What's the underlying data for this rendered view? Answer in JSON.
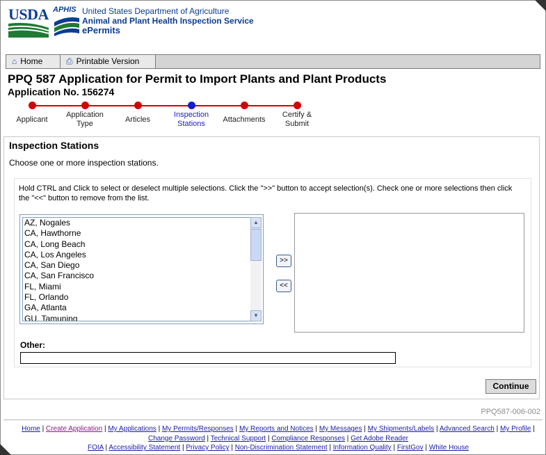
{
  "header": {
    "usda_logo_text": "USDA",
    "aphis_logo_text": "APHIS",
    "agency_line1": "United States Department of Agriculture",
    "agency_line2": "Animal and Plant Health Inspection Service",
    "app_name": "ePermits"
  },
  "toolbar": {
    "home_label": "Home",
    "print_label": "Printable Version"
  },
  "page": {
    "title": "PPQ 587 Application for Permit to Import Plants and Plant Products",
    "application_no": "Application No. 156274"
  },
  "steps": [
    {
      "label": "Applicant",
      "current": false
    },
    {
      "label": "Application Type",
      "current": false
    },
    {
      "label": "Articles",
      "current": false
    },
    {
      "label": "Inspection Stations",
      "current": true
    },
    {
      "label": "Attachments",
      "current": false
    },
    {
      "label": "Certify & Submit",
      "current": false
    }
  ],
  "section": {
    "title": "Inspection Stations",
    "subtitle": "Choose one or more inspection stations.",
    "instructions": "Hold CTRL and Click to select or deselect multiple selections. Click the \">>\" button to accept selection(s). Check one or more selections then click the \"<<\" button to remove from the list."
  },
  "available_stations": [
    "AZ, Nogales",
    "CA, Hawthorne",
    "CA, Long Beach",
    "CA, Los Angeles",
    "CA, San Diego",
    "CA, San Francisco",
    "FL, Miami",
    "FL, Orlando",
    "GA, Atlanta",
    "GU, Tamuning"
  ],
  "buttons": {
    "add": ">>",
    "remove": "<<",
    "continue": "Continue"
  },
  "other": {
    "label": "Other:",
    "value": ""
  },
  "page_id": "PPQ587-006-002",
  "footer": {
    "row1": [
      "Home",
      "Create Application",
      "My Applications",
      "My Permits/Responses",
      "My Reports and Notices",
      "My Messages",
      "My Shipments/Labels",
      "Advanced Search",
      "My Profile",
      "Change Password",
      "Technical Support",
      "Compliance Responses",
      "Get Adobe Reader"
    ],
    "row2": [
      "FOIA",
      "Accessibility Statement",
      "Privacy Policy",
      "Non-Discrimination Statement",
      "Information Quality",
      "FirstGov",
      "White House"
    ]
  },
  "colors": {
    "step_done": "#d40000",
    "step_current": "#1a1acc",
    "brand_blue": "#0b3d91"
  },
  "icons": [
    "home-icon",
    "printer-icon",
    "scroll-up-icon",
    "scroll-down-icon"
  ]
}
